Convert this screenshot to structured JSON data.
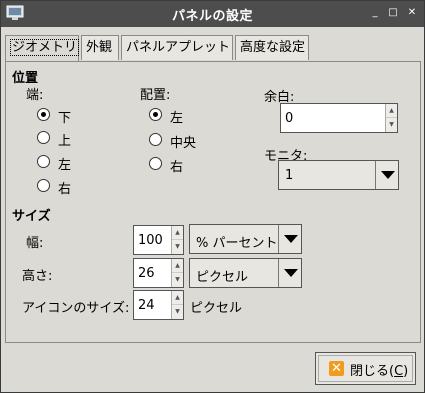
{
  "window": {
    "title": "パネルの設定",
    "controls": {
      "minimize": "_",
      "maximize": "□",
      "close": "✕"
    }
  },
  "tabs": [
    {
      "label": "ジオメトリ",
      "active": true
    },
    {
      "label": "外観",
      "active": false
    },
    {
      "label": "パネルアプレット",
      "active": false
    },
    {
      "label": "高度な設定",
      "active": false
    }
  ],
  "position": {
    "heading": "位置",
    "edge": {
      "label": "端:",
      "options": [
        "下",
        "上",
        "左",
        "右"
      ],
      "selected": "下"
    },
    "alignment": {
      "label": "配置:",
      "options": [
        "左",
        "中央",
        "右"
      ],
      "selected": "左"
    },
    "margin": {
      "label": "余白:",
      "value": "0"
    },
    "monitor": {
      "label": "モニタ:",
      "value": "1"
    }
  },
  "size": {
    "heading": "サイズ",
    "width": {
      "label": "幅:",
      "value": "100",
      "unit": "% パーセント"
    },
    "height": {
      "label": "高さ:",
      "value": "26",
      "unit": "ピクセル"
    },
    "icon_size": {
      "label": "アイコンのサイズ:",
      "value": "24",
      "unit": "ピクセル"
    }
  },
  "footer": {
    "close_label": "閉じる(",
    "close_mnemonic": "C",
    "close_suffix": ")"
  },
  "colors": {
    "titlebar": "#4d4d4d",
    "window_bg": "#dcdad5",
    "close_icon": "#f29c1f"
  }
}
